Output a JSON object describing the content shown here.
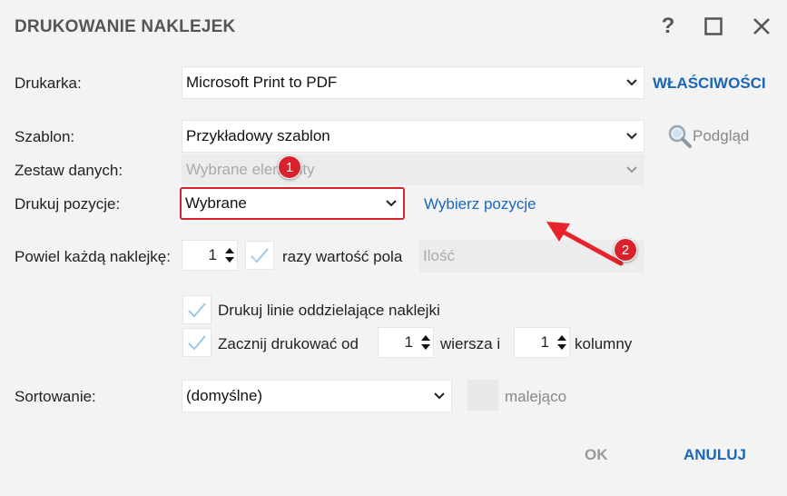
{
  "window": {
    "title": "DRUKOWANIE NAKLEJEK",
    "help_glyph": "?",
    "maximize_icon": "maximize-icon",
    "close_icon": "close-icon"
  },
  "printer": {
    "label": "Drukarka:",
    "value": "Microsoft Print to PDF",
    "properties_link": "WŁAŚCIWOŚCI"
  },
  "template": {
    "label": "Szablon:",
    "value": "Przykładowy szablon",
    "preview_label": "Podgląd"
  },
  "dataset": {
    "label": "Zestaw danych:",
    "value": "Wybrane elementy"
  },
  "print_positions": {
    "label": "Drukuj pozycje:",
    "value": "Wybrane",
    "choose_link": "Wybierz pozycje"
  },
  "duplicate": {
    "label": "Powiel każdą naklejkę:",
    "count": "1",
    "times_label": "razy wartość pola",
    "field_value": "Ilość"
  },
  "options": {
    "separator_lines_label": "Drukuj linie oddzielające naklejki",
    "start_print_label": "Zacznij drukować od",
    "start_row": "1",
    "row_label": "wiersza i",
    "start_column": "1",
    "column_label": "kolumny"
  },
  "sorting": {
    "label": "Sortowanie:",
    "value": "(domyślne)",
    "descending_label": "malejąco"
  },
  "buttons": {
    "ok": "OK",
    "cancel": "ANULUJ"
  },
  "annotations": {
    "marker_1": "1",
    "marker_2": "2"
  },
  "colors": {
    "accent": "#1b67b5",
    "highlight": "#d9232c",
    "check": "#9cc7e6"
  }
}
